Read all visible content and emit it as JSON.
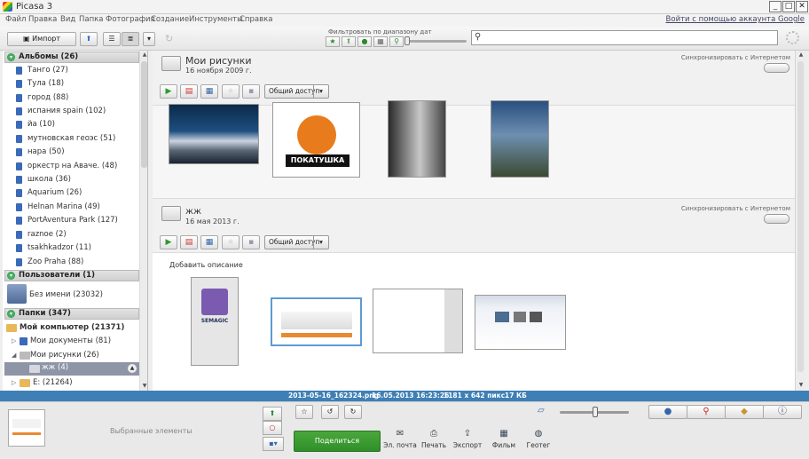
{
  "window": {
    "title": "Picasa 3",
    "min": "_",
    "max": "□",
    "close": "✕"
  },
  "menu": {
    "items": [
      "Файл",
      "Правка",
      "Вид",
      "Папка",
      "Фотография",
      "Создание",
      "Инструменты",
      "Справка"
    ],
    "google_link": "Войти с помощью аккаунта Google"
  },
  "toolbar": {
    "import_label": "Импорт",
    "filter_label": "Фильтровать по диапазону дат",
    "search": {
      "value": "",
      "placeholder": ""
    }
  },
  "sidebar": {
    "albums_header": "Альбомы (26)",
    "albums": [
      "Танго (27)",
      "Тула (18)",
      "город (88)",
      "испания spain (102)",
      "йа (10)",
      "мутновская геоэс (51)",
      "нара (50)",
      "оркестр на Аваче. (48)",
      "школа (36)",
      "Aquarium (26)",
      "Helnan Marina (49)",
      "PortAventura Park (127)",
      "raznoe (2)",
      "tsakhkadzor (11)",
      "Zoo Praha (88)"
    ],
    "users_header": "Пользователи (1)",
    "user_name": "Без имени (23032)",
    "folders_header": "Папки (347)",
    "my_computer": "Мой компьютер (21371)",
    "my_docs": "Мои документы (81)",
    "my_pictures": "Мои рисунки (26)",
    "selected_folder": "жж (4)",
    "drive_e": "E: (21264)"
  },
  "albums": [
    {
      "title": "Мои рисунки",
      "date": "16 ноября 2009 г.",
      "sync": "Синхронизировать с Интернетом",
      "share": "Общий доступ"
    },
    {
      "title": "жж",
      "date": "16 мая 2013 г.",
      "sync": "Синхронизировать с Интернетом",
      "share": "Общий доступ",
      "add_description": "Добавить описание"
    }
  ],
  "thumbnails": {
    "logo_text": "ПОКАТУШКА",
    "semagic_text": "SEMAGIC"
  },
  "status": {
    "filename": "2013-05-16_162324.png",
    "datetime": "16.05.2013 16:23:26",
    "dimensions": "1181 x 642 пикс.",
    "size": "17 КБ"
  },
  "tray": {
    "selected_label": "Выбранные элементы",
    "share_label": "Поделиться",
    "actions": [
      "Эл. почта",
      "Печать",
      "Экспорт",
      "Фильм",
      "Геотег"
    ]
  },
  "colors": {
    "status_bar": "#3e7fb5",
    "share_green": "#3a9b32",
    "album_icon": "#3a6ab8"
  }
}
